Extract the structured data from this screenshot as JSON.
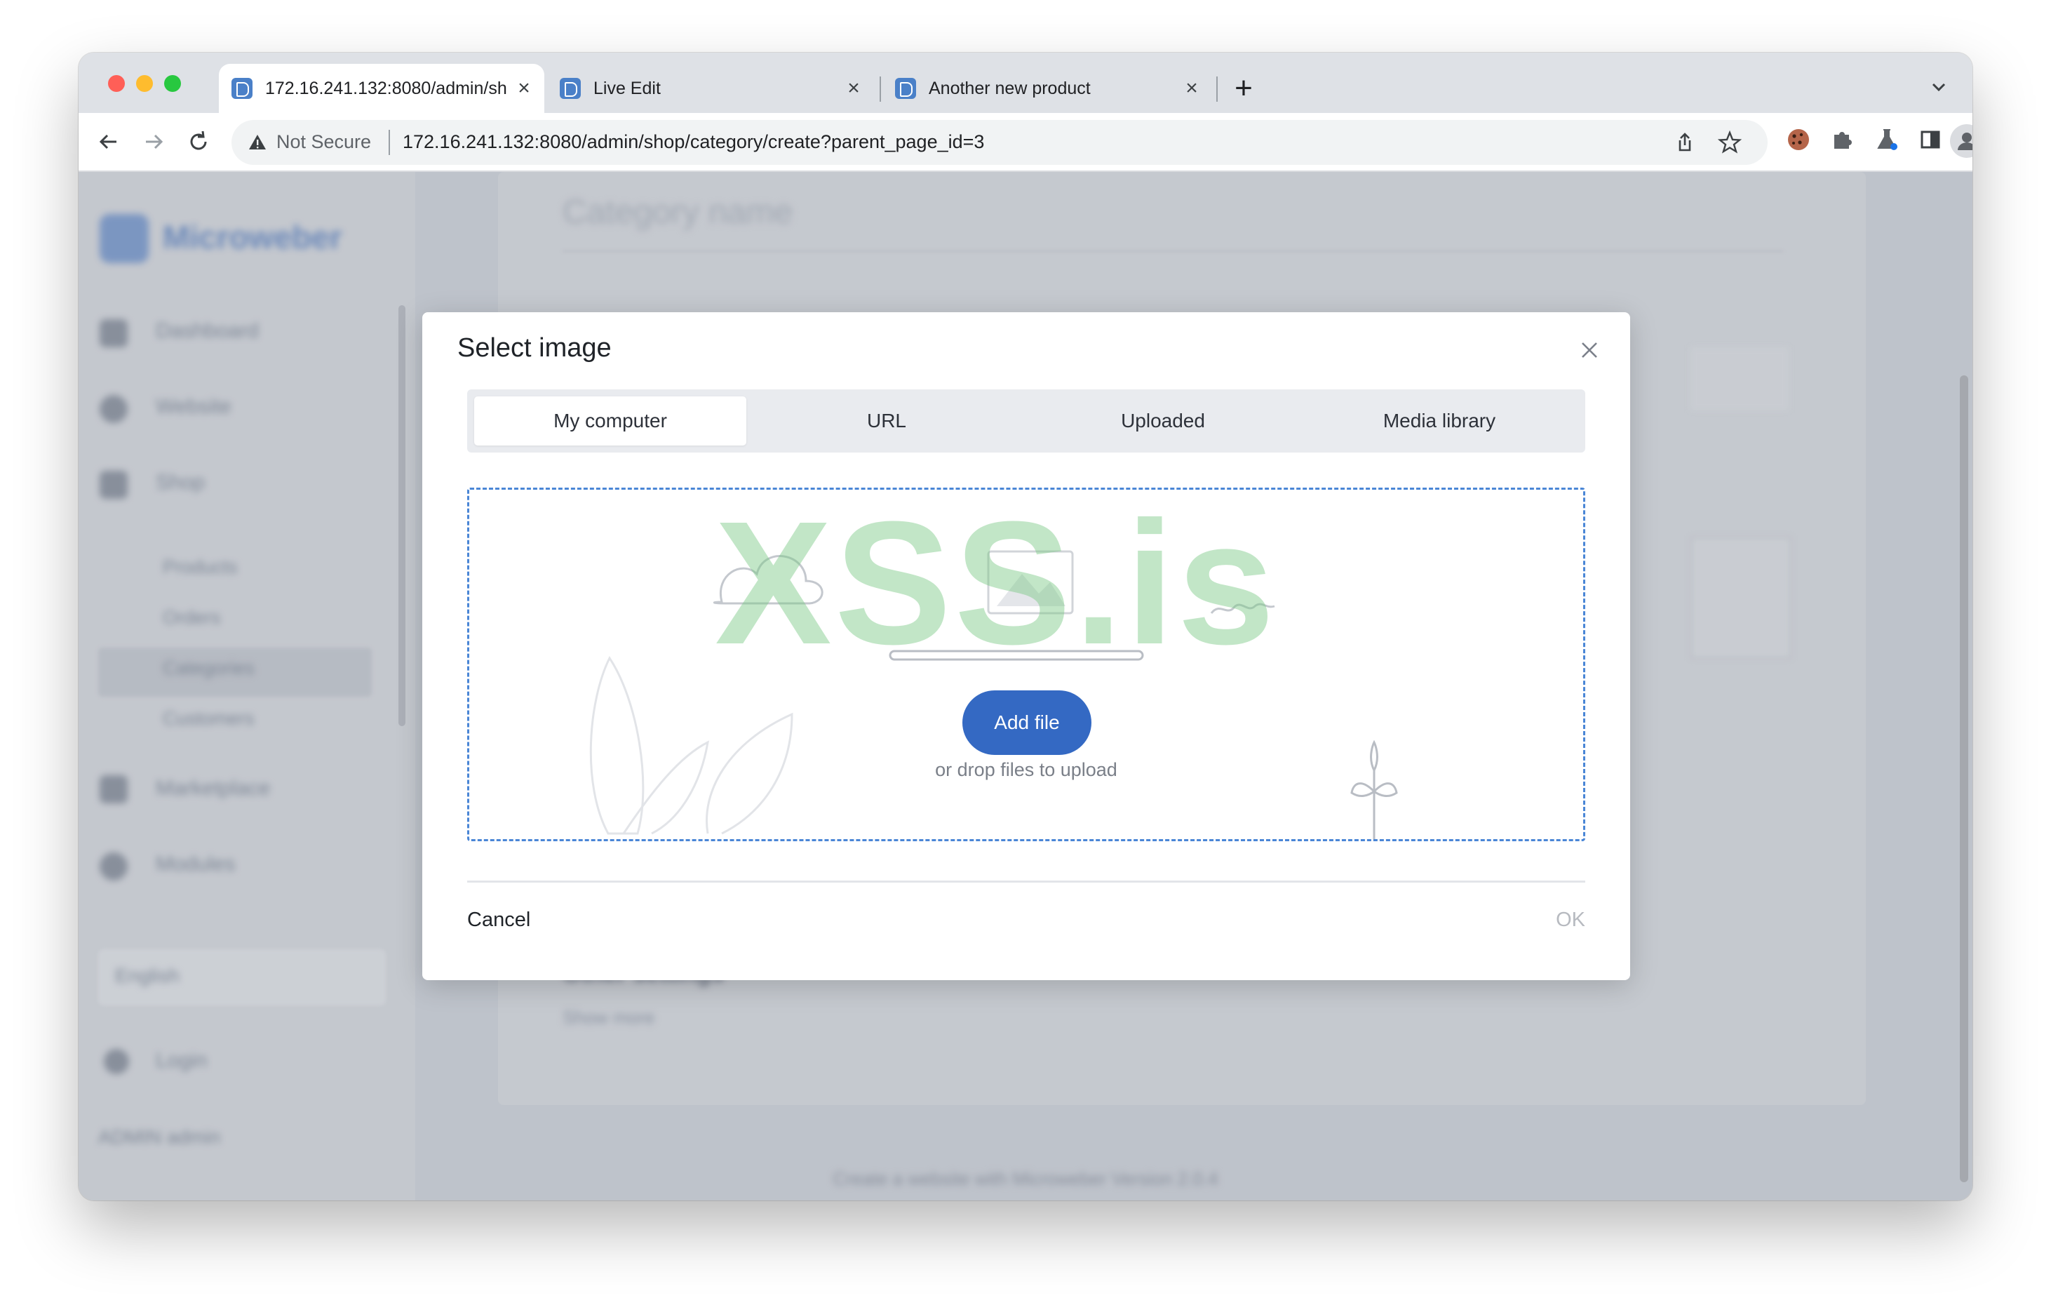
{
  "browser": {
    "tabs": [
      {
        "title": "172.16.241.132:8080/admin/sh"
      },
      {
        "title": "Live Edit"
      },
      {
        "title": "Another new product"
      }
    ],
    "security_label": "Not Secure",
    "url": "172.16.241.132:8080/admin/shop/category/create?parent_page_id=3"
  },
  "modal": {
    "title": "Select image",
    "tabs": [
      "My computer",
      "URL",
      "Uploaded",
      "Media library"
    ],
    "active_tab": "My computer",
    "add_file_label": "Add file",
    "drop_hint": "or drop files to upload",
    "cancel_label": "Cancel",
    "ok_label": "OK",
    "watermark": "XSS.is"
  },
  "background": {
    "brand": "Microweber",
    "sidebar_items": [
      "Dashboard",
      "Website",
      "Shop",
      "Marketplace",
      "Modules"
    ],
    "shop_subitems": [
      "Products",
      "Orders",
      "Categories",
      "Customers"
    ],
    "language": "English",
    "login": "Login",
    "user": "ADMIN admin",
    "category_name_placeholder": "Category name",
    "other_settings": "Other settings",
    "show_more": "Show more",
    "footer": "Create a website with Microweber Version 2.0.4"
  },
  "colors": {
    "accent": "#3469c3",
    "dashed_border": "#4a86d6"
  }
}
